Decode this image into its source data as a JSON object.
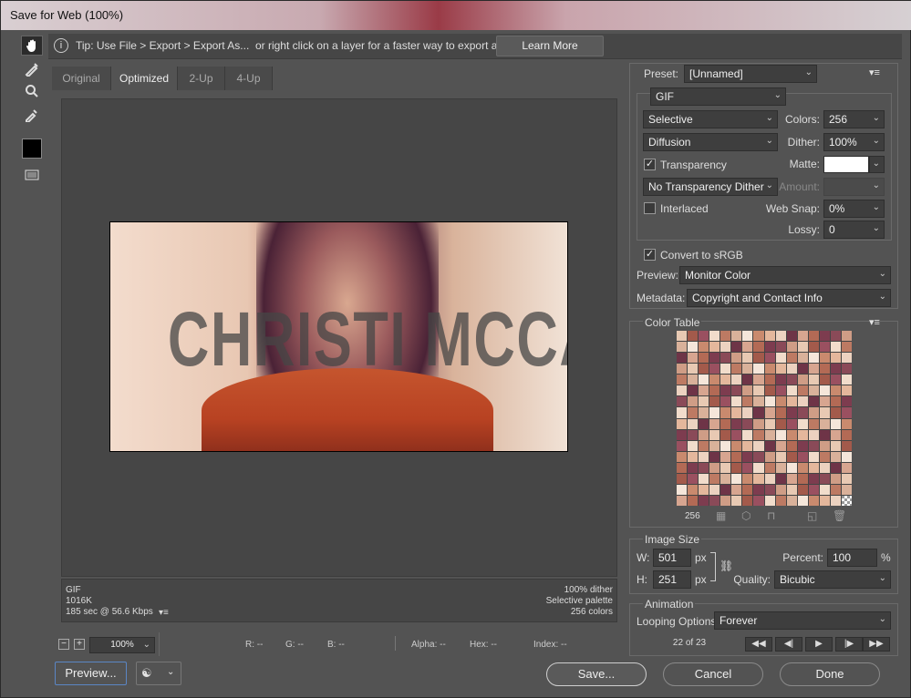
{
  "window": {
    "title": "Save for Web (100%)"
  },
  "tip": {
    "text": "Tip: Use File > Export > Export As...  or right click on a layer for a faster way to export assets",
    "learn_more": "Learn More"
  },
  "tabs": [
    {
      "label": "Original"
    },
    {
      "label": "Optimized"
    },
    {
      "label": "2-Up"
    },
    {
      "label": "4-Up"
    }
  ],
  "image": {
    "overlay_text": "CHRISTI MCCALL"
  },
  "info_left": [
    "GIF",
    "1016K",
    "185 sec @ 56.6 Kbps"
  ],
  "info_right": [
    "100% dither",
    "Selective palette",
    "256 colors"
  ],
  "status": {
    "zoom": "100%",
    "r": "R: --",
    "g": "G: --",
    "b": "B: --",
    "alpha": "Alpha: --",
    "hex": "Hex: --",
    "index": "Index: --"
  },
  "buttons": {
    "preview": "Preview...",
    "save": "Save...",
    "cancel": "Cancel",
    "done": "Done"
  },
  "settings": {
    "preset_label": "Preset:",
    "preset_value": "[Unnamed]",
    "format": "GIF",
    "reduction": "Selective",
    "colors_label": "Colors:",
    "colors_value": "256",
    "dither_method": "Diffusion",
    "dither_label": "Dither:",
    "dither_value": "100%",
    "transparency_label": "Transparency",
    "matte_label": "Matte:",
    "transparency_dither": "No Transparency Dither",
    "amount_label": "Amount:",
    "interlaced_label": "Interlaced",
    "websnap_label": "Web Snap:",
    "websnap_value": "0%",
    "lossy_label": "Lossy:",
    "lossy_value": "0",
    "srgb_label": "Convert to sRGB",
    "preview_label": "Preview:",
    "preview_value": "Monitor Color",
    "metadata_label": "Metadata:",
    "metadata_value": "Copyright and Contact Info"
  },
  "color_table": {
    "title": "Color Table",
    "count": "256",
    "colors": [
      "#e8c9b3",
      "#c98a6e",
      "#8a4a58",
      "#d9b19a",
      "#b36a55",
      "#f1dccb",
      "#6e3447",
      "#a35a4b",
      "#e4b79c",
      "#cf9d86",
      "#f5e6da",
      "#7d3c4f",
      "#bd7a63",
      "#d7a590",
      "#9a5060",
      "#ecd2c0"
    ]
  },
  "image_size": {
    "title": "Image Size",
    "w_label": "W:",
    "w_value": "501",
    "h_label": "H:",
    "h_value": "251",
    "px": "px",
    "percent_label": "Percent:",
    "percent_value": "100",
    "percent_unit": "%",
    "quality_label": "Quality:",
    "quality_value": "Bicubic"
  },
  "animation": {
    "title": "Animation",
    "looping_label": "Looping Options:",
    "looping_value": "Forever",
    "frame": "22 of 23"
  }
}
